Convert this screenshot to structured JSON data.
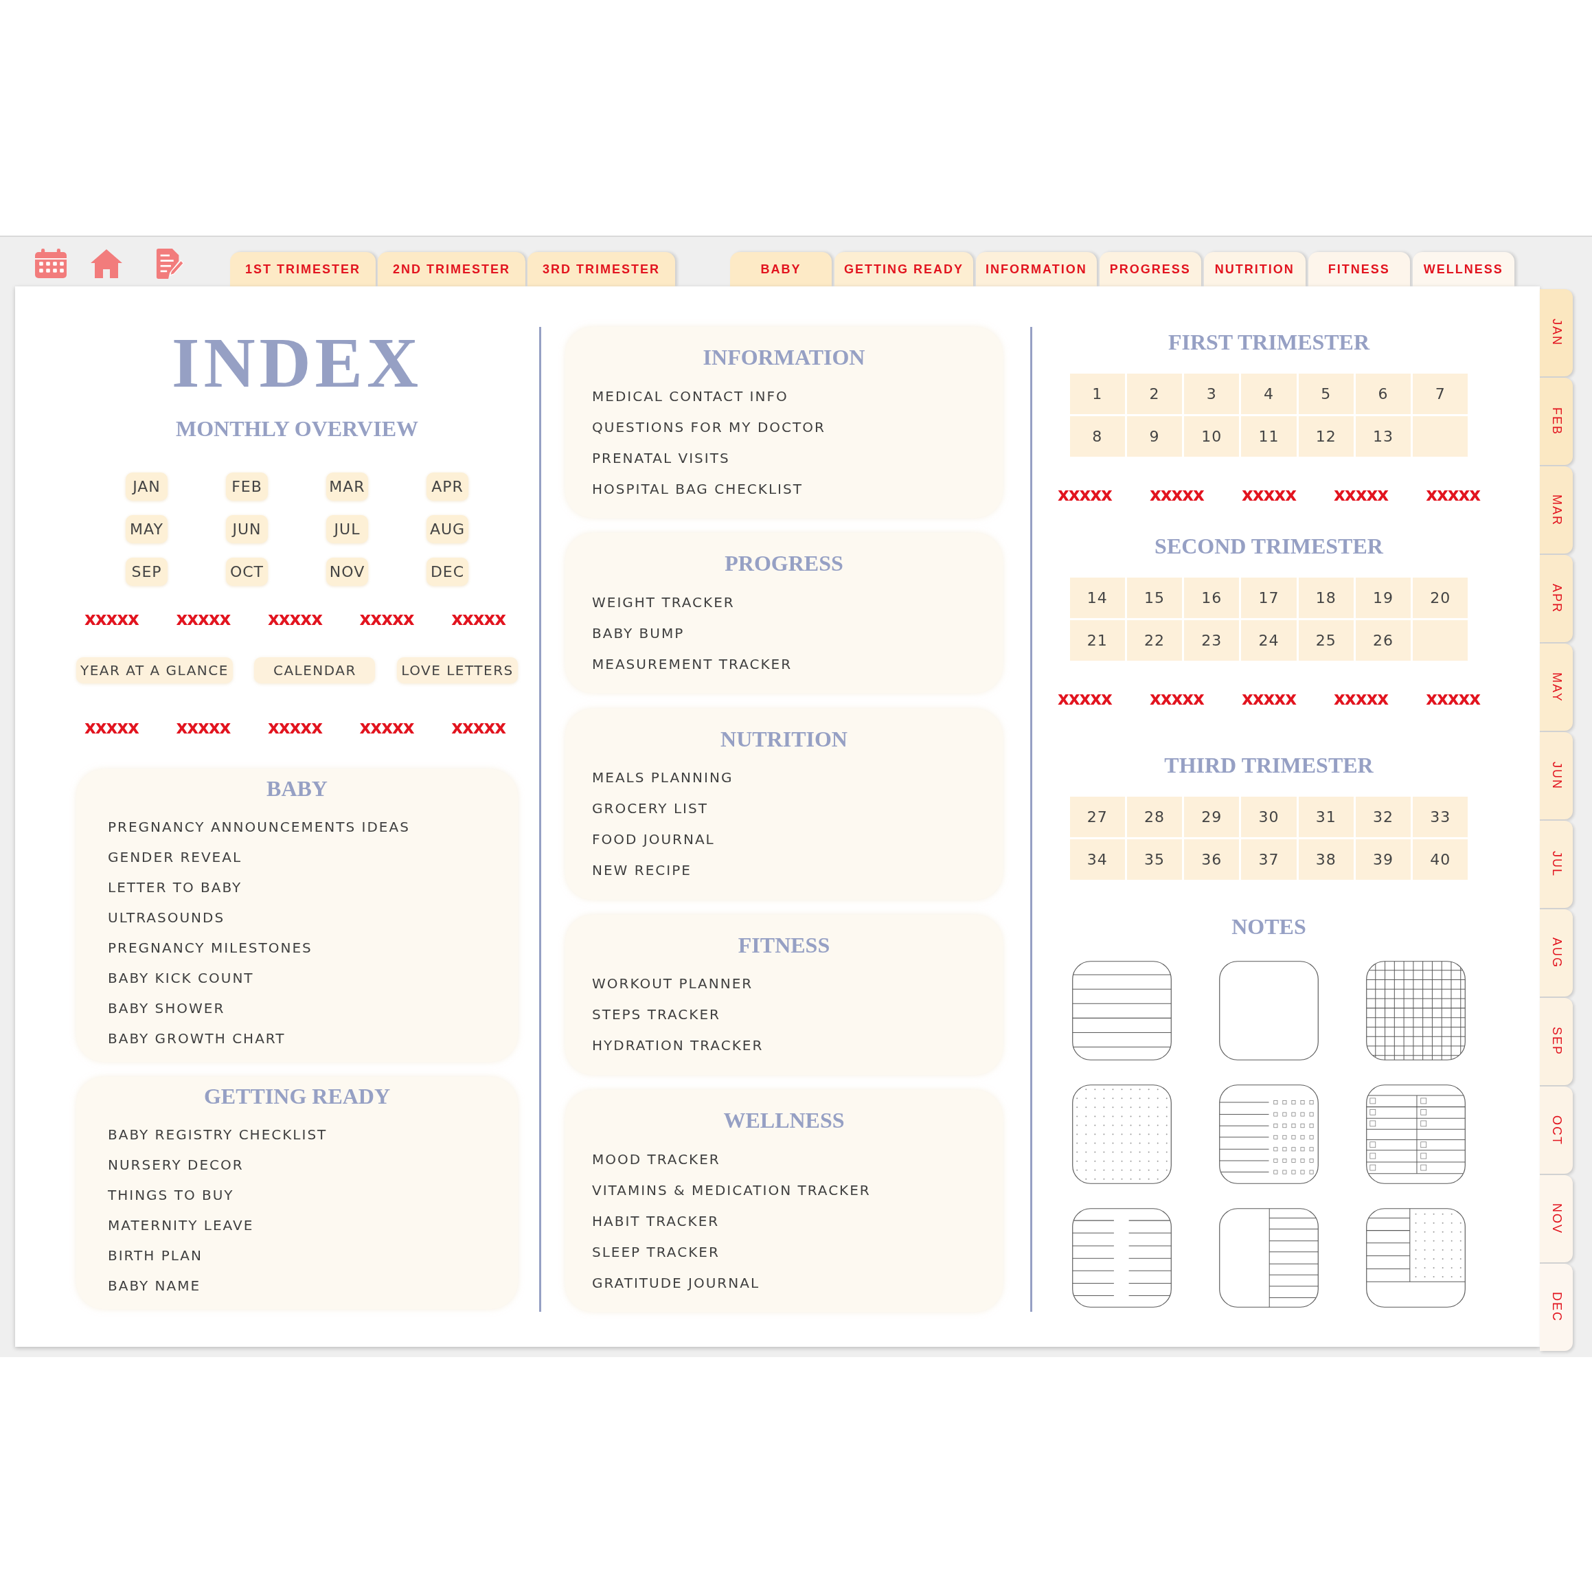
{
  "trimester_tabs": [
    "1ST TRIMESTER",
    "2ND TRIMESTER",
    "3RD TRIMESTER"
  ],
  "section_tabs": [
    "BABY",
    "GETTING READY",
    "INFORMATION",
    "PROGRESS",
    "NUTRITION",
    "FITNESS",
    "WELLNESS"
  ],
  "month_tabs": [
    "JAN",
    "FEB",
    "MAR",
    "APR",
    "MAY",
    "JUN",
    "JUL",
    "AUG",
    "SEP",
    "OCT",
    "NOV",
    "DEC"
  ],
  "index": {
    "title": "INDEX",
    "subtitle": "MONTHLY OVERVIEW",
    "months": [
      "JAN",
      "FEB",
      "MAR",
      "APR",
      "MAY",
      "JUN",
      "JUL",
      "AUG",
      "SEP",
      "OCT",
      "NOV",
      "DEC"
    ],
    "marks_top": [
      "xxxxx",
      "xxxxx",
      "xxxxx",
      "xxxxx",
      "xxxxx"
    ],
    "links": [
      "YEAR AT A GLANCE",
      "CALENDAR",
      "LOVE LETTERS"
    ],
    "marks_bottom": [
      "xxxxx",
      "xxxxx",
      "xxxxx",
      "xxxxx",
      "xxxxx"
    ]
  },
  "left_sections": [
    {
      "title": "BABY",
      "items": [
        "PREGNANCY ANNOUNCEMENTS IDEAS",
        "GENDER REVEAL",
        "LETTER TO BABY",
        "ULTRASOUNDS",
        "PREGNANCY MILESTONES",
        "BABY KICK COUNT",
        "BABY SHOWER",
        "BABY GROWTH CHART"
      ]
    },
    {
      "title": "GETTING READY",
      "items": [
        "BABY REGISTRY CHECKLIST",
        "NURSERY DECOR",
        "THINGS TO BUY",
        "MATERNITY LEAVE",
        "BIRTH PLAN",
        "BABY NAME"
      ]
    }
  ],
  "middle_sections": [
    {
      "title": "INFORMATION",
      "items": [
        "MEDICAL CONTACT INFO",
        "QUESTIONS FOR MY DOCTOR",
        "PRENATAL VISITS",
        "HOSPITAL BAG CHECKLIST"
      ]
    },
    {
      "title": "PROGRESS",
      "items": [
        "WEIGHT TRACKER",
        "BABY BUMP",
        "MEASUREMENT TRACKER"
      ]
    },
    {
      "title": "NUTRITION",
      "items": [
        "MEALS PLANNING",
        "GROCERY LIST",
        "FOOD JOURNAL",
        "NEW RECIPE"
      ]
    },
    {
      "title": "FITNESS",
      "items": [
        "WORKOUT PLANNER",
        "STEPS TRACKER",
        "HYDRATION TRACKER"
      ]
    },
    {
      "title": "WELLNESS",
      "items": [
        "MOOD TRACKER",
        "VITAMINS & MEDICATION TRACKER",
        "HABIT TRACKER",
        "SLEEP TRACKER",
        "GRATITUDE JOURNAL"
      ]
    }
  ],
  "trimesters": [
    {
      "title": "FIRST TRIMESTER",
      "weeks": [
        "1",
        "2",
        "3",
        "4",
        "5",
        "6",
        "7",
        "8",
        "9",
        "10",
        "11",
        "12",
        "13"
      ],
      "marks": [
        "xxxxx",
        "xxxxx",
        "xxxxx",
        "xxxxx",
        "xxxxx"
      ]
    },
    {
      "title": "SECOND TRIMESTER",
      "weeks": [
        "14",
        "15",
        "16",
        "17",
        "18",
        "19",
        "20",
        "21",
        "22",
        "23",
        "24",
        "25",
        "26"
      ],
      "marks": [
        "xxxxx",
        "xxxxx",
        "xxxxx",
        "xxxxx",
        "xxxxx"
      ]
    },
    {
      "title": "THIRD TRIMESTER",
      "weeks": [
        "27",
        "28",
        "29",
        "30",
        "31",
        "32",
        "33",
        "34",
        "35",
        "36",
        "37",
        "38",
        "39",
        "40"
      ]
    }
  ],
  "notes": {
    "title": "NOTES"
  }
}
